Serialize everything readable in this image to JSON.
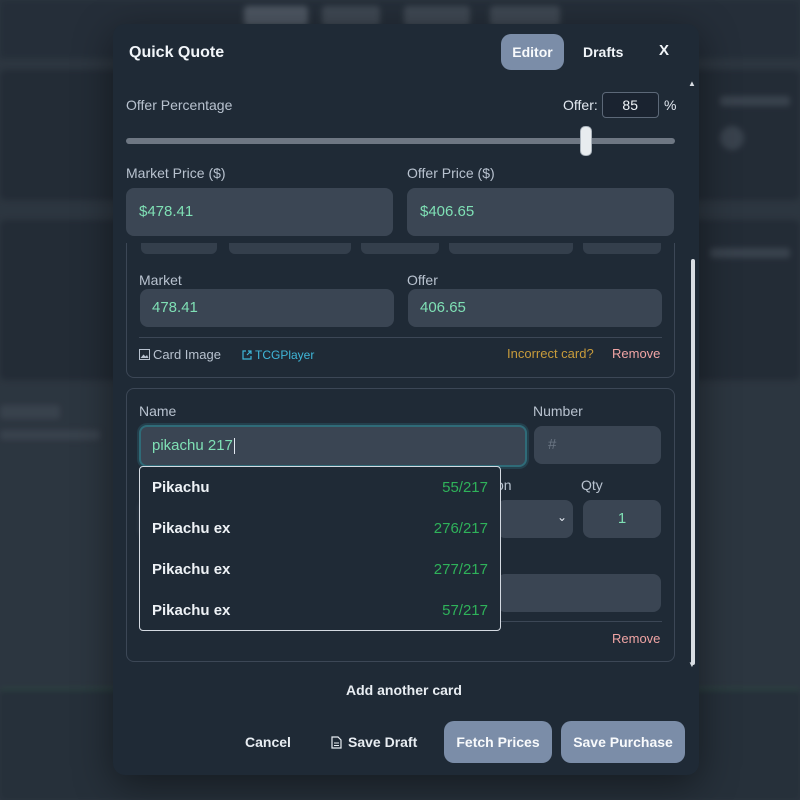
{
  "modal": {
    "title": "Quick Quote",
    "tabs": {
      "editor": "Editor",
      "drafts": "Drafts"
    },
    "close": "X"
  },
  "offer": {
    "label": "Offer Percentage",
    "value_label": "Offer:",
    "value": "85",
    "unit": "%",
    "slider_percent": 85
  },
  "prices": {
    "market_label": "Market Price ($)",
    "market_value": "$478.41",
    "offer_label": "Offer Price ($)",
    "offer_value": "$406.65"
  },
  "card1": {
    "market_label": "Market",
    "market_value": "478.41",
    "offer_label": "Offer",
    "offer_value": "406.65",
    "card_image": "Card Image",
    "tcgplayer": "TCGPlayer",
    "incorrect": "Incorrect card?",
    "remove": "Remove"
  },
  "card2": {
    "name_label": "Name",
    "name_value": "pikachu 217",
    "number_label": "Number",
    "number_placeholder": "#",
    "condition_fragment": "on",
    "qty_label": "Qty",
    "qty_value": "1",
    "remove": "Remove"
  },
  "suggestions": [
    {
      "name": "Pikachu",
      "number": "55/217"
    },
    {
      "name": "Pikachu ex",
      "number": "276/217"
    },
    {
      "name": "Pikachu ex",
      "number": "277/217"
    },
    {
      "name": "Pikachu ex",
      "number": "57/217"
    }
  ],
  "footer": {
    "add_card": "Add another card",
    "cancel": "Cancel",
    "save_draft": "Save Draft",
    "fetch_prices": "Fetch Prices",
    "save_purchase": "Save Purchase"
  },
  "colors": {
    "accent": "#7b8da8",
    "value_green": "#7fe0b5",
    "number_green": "#2fb25a",
    "remove_red": "#f0a4a4",
    "link_cyan": "#3fb6d8",
    "warning": "#c79b3b"
  }
}
